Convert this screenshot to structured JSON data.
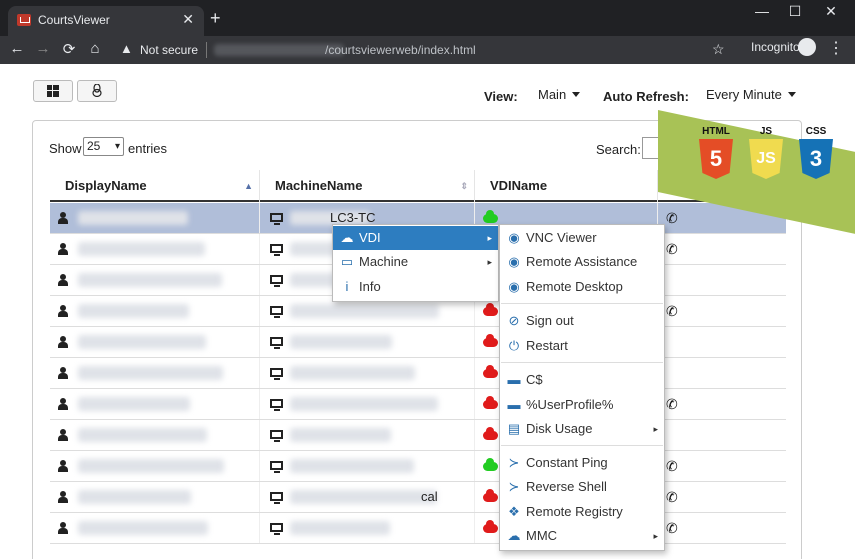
{
  "browser": {
    "tab_title": "CourtsViewer",
    "tab_close": "✕",
    "new_tab": "+",
    "window_controls": [
      "—",
      "☐",
      "✕"
    ],
    "nav": [
      "←",
      "→",
      "⟳",
      "⌂"
    ],
    "security_icon": "▲",
    "security_label": "Not secure",
    "url": "/courtsviewerweb/index.html",
    "bookmark": "☆",
    "incognito_label": "Incognito",
    "menu": "⋮"
  },
  "page": {
    "os_buttons": [
      "windows-icon",
      "linux-icon"
    ],
    "view_label": "View:",
    "view_value": "Main",
    "auto_refresh_label": "Auto Refresh:",
    "auto_refresh_value": "Every Minute",
    "show_label": "Show",
    "entries_value": "25",
    "entries_label": "entries",
    "search_label": "Search:"
  },
  "table": {
    "columns": [
      "DisplayName",
      "MachineName",
      "VDIName"
    ],
    "sort_up": "▲",
    "sort_both": "⇕",
    "rows": [
      {
        "machine": "LC3-TC",
        "vdi": "green",
        "phone": true,
        "selected": true
      },
      {
        "machine": "",
        "vdi": "",
        "phone": true
      },
      {
        "machine": "",
        "vdi": "",
        "phone": false
      },
      {
        "machine": "",
        "vdi": "red",
        "phone": true
      },
      {
        "machine": "",
        "vdi": "red",
        "phone": false
      },
      {
        "machine": "",
        "vdi": "red",
        "phone": false
      },
      {
        "machine": "",
        "vdi": "red",
        "phone": true
      },
      {
        "machine": "",
        "vdi": "red",
        "phone": false
      },
      {
        "machine": "",
        "vdi": "green",
        "phone": true
      },
      {
        "machine": "cal",
        "vdi": "red",
        "phone": true
      },
      {
        "machine": "",
        "vdi": "red",
        "phone": true
      }
    ]
  },
  "menu_main": [
    {
      "label": "VDI",
      "icon": "cloud-icon",
      "submenu": true,
      "active": true
    },
    {
      "label": "Machine",
      "icon": "monitor-icon",
      "submenu": true
    },
    {
      "label": "Info",
      "icon": "info-icon",
      "submenu": false
    }
  ],
  "menu_vdi": [
    {
      "label": "VNC Viewer",
      "icon": "eye-icon"
    },
    {
      "label": "Remote Assistance",
      "icon": "eye-icon"
    },
    {
      "label": "Remote Desktop",
      "icon": "eye-icon"
    },
    {
      "label": "Sign out",
      "icon": "user-slash-icon"
    },
    {
      "label": "Restart",
      "icon": "power-icon"
    },
    {
      "label": "C$",
      "icon": "folder-icon"
    },
    {
      "label": "%UserProfile%",
      "icon": "folder-icon"
    },
    {
      "label": "Disk Usage",
      "icon": "disk-icon",
      "submenu": true
    },
    {
      "label": "Constant Ping",
      "icon": "terminal-icon"
    },
    {
      "label": "Reverse Shell",
      "icon": "terminal-icon"
    },
    {
      "label": "Remote Registry",
      "icon": "cubes-icon"
    },
    {
      "label": "MMC",
      "icon": "cloud-icon",
      "submenu": true
    }
  ],
  "ribbon": {
    "badges": [
      {
        "title": "HTML",
        "glyph": "5",
        "color": "#e44d26"
      },
      {
        "title": "JS",
        "glyph": "JS",
        "color": "#f0db4f"
      },
      {
        "title": "CSS",
        "glyph": "3",
        "color": "#1572b6"
      }
    ]
  },
  "colors": {
    "selected_row": "#b0bed9",
    "menu_active": "#2d7dc0",
    "icon_blue": "#2a6fad",
    "status_red": "#e01b1b",
    "status_green": "#22cc22"
  }
}
